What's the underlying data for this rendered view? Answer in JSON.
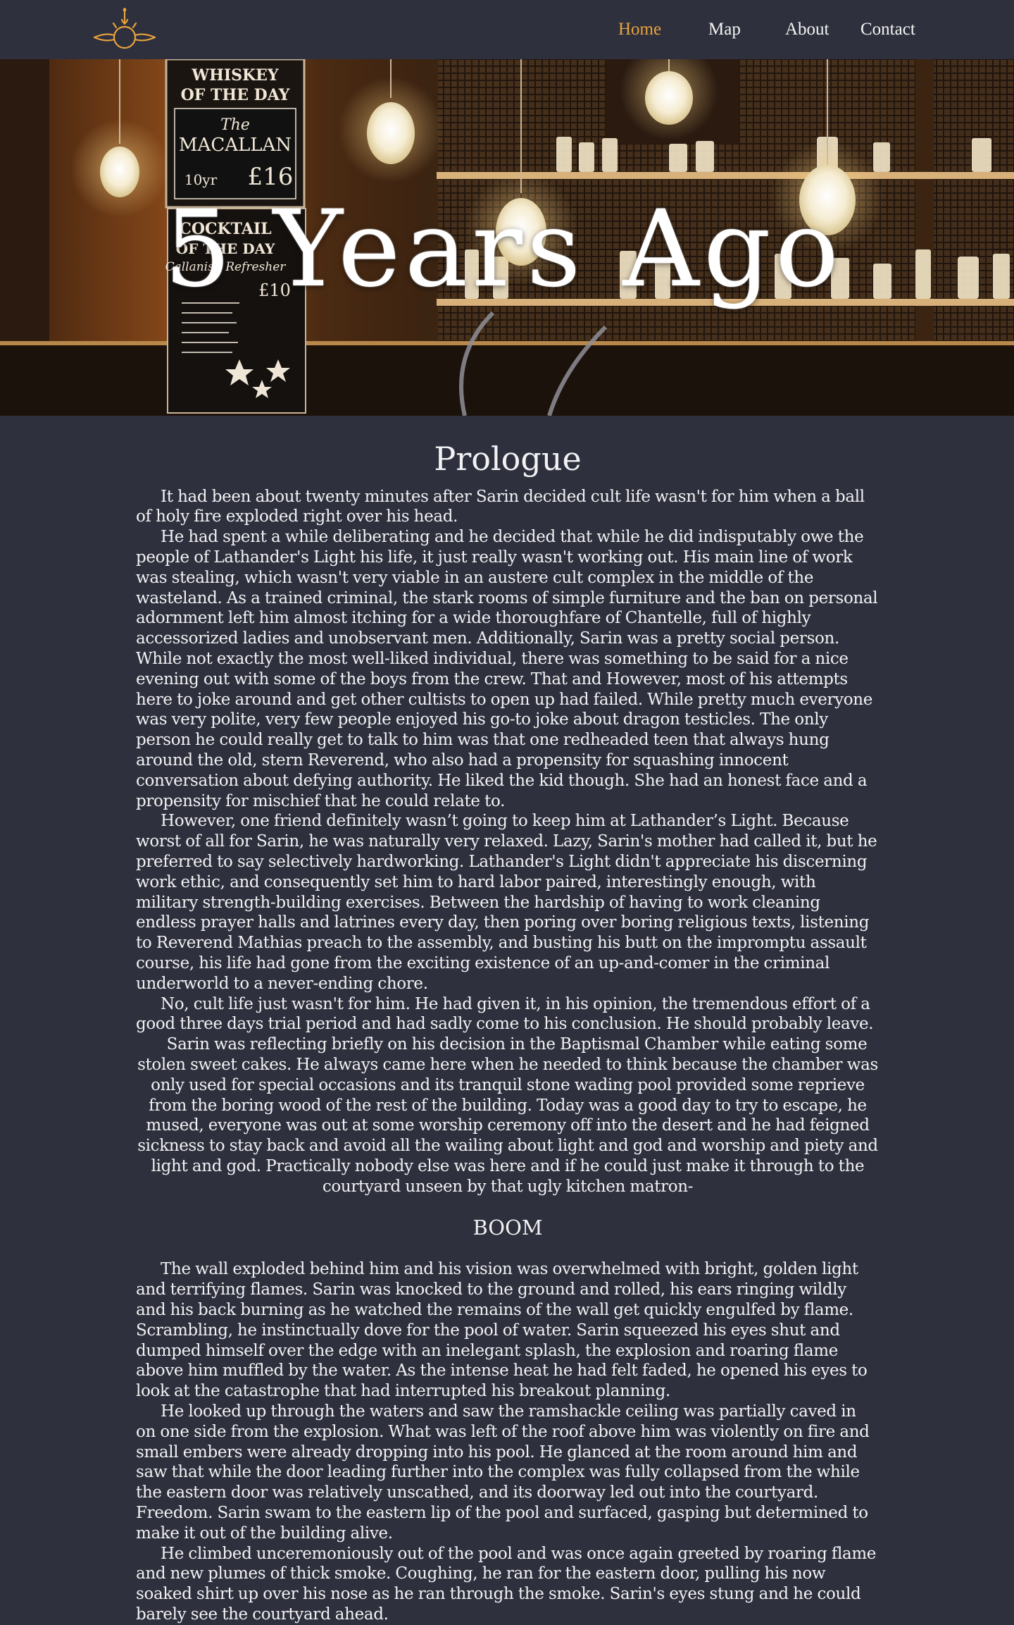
{
  "header": {
    "logo_name": "sun-compass-logo",
    "accent_color": "#e8a33d",
    "nav": [
      {
        "label": "Home",
        "active": true
      },
      {
        "label": "Map",
        "active": false
      },
      {
        "label": "About",
        "active": false
      },
      {
        "label": "Contact",
        "active": false
      }
    ]
  },
  "hero": {
    "title": "5 Years Ago",
    "signs": {
      "whiskey_line1": "WHISKEY",
      "whiskey_line2": "OF THE DAY",
      "the": "The",
      "macallan": "MACALLAN",
      "price_small": "10yr",
      "price": "£16",
      "cocktail_line1": "COCKTAIL",
      "cocktail_line2": "OF THE DAY",
      "cocktail_name": "Callanish Refresher",
      "cocktail_price": "£10"
    }
  },
  "story": {
    "chapter_title": "Prologue",
    "paragraphs_part1": [
      "It had been about twenty minutes after Sarin decided cult life wasn't for him when a ball of holy fire exploded right over his head.",
      "He had spent a while deliberating and he decided that while he did indisputably owe the people of Lathander's Light his life, it just really wasn't working out. His main line of work was stealing, which wasn't very viable in an austere cult complex in the middle of the wasteland. As a trained criminal, the stark rooms of simple furniture and the ban on personal adornment left him almost itching for a wide thoroughfare of Chantelle, full of highly accessorized ladies and unobservant men. Additionally, Sarin was a pretty social person. While not exactly the most well-liked individual, there was something to be said for a nice evening out with some of the boys from the crew. That and However, most of his attempts here to joke around and get other cultists to open up had failed. While pretty much everyone was very polite, very few people enjoyed his go-to joke about dragon testicles. The only person he could really get to talk to him was that one redheaded teen that always hung around the old, stern Reverend, who also had a propensity for squashing innocent conversation about defying authority. He liked the kid though. She had an honest face and a propensity for mischief that he could relate to.",
      "However, one friend definitely wasn’t going to keep him at Lathander’s Light. Because worst of all for Sarin, he was naturally very relaxed. Lazy, Sarin's mother had called it, but he preferred to say selectively hardworking. Lathander's Light didn't appreciate his discerning work ethic, and consequently set him to hard labor paired, interestingly enough, with military strength-building exercises. Between the hardship of having to work cleaning endless prayer halls and latrines every day, then poring over boring religious texts, listening to Reverend Mathias preach to the assembly, and busting his butt on the impromptu assault course, his life had gone from the exciting existence of an up-and-comer in the criminal underworld to a never-ending chore.",
      "No, cult life just wasn't for him. He had given it, in his opinion, the tremendous effort of a good three days trial period and had sadly come to his conclusion. He should probably leave."
    ],
    "paragraph_centered": "Sarin was reflecting briefly on his decision in the Baptismal Chamber while eating some stolen sweet cakes. He always came here when he needed to think because the chamber was only used for special occasions and its tranquil stone wading pool provided some reprieve from the boring wood of the rest of the building. Today was a good day to try to escape, he mused, everyone was out at some worship ceremony off into the desert and he had feigned sickness to stay back and avoid all the wailing about light and god and worship and piety and light and god. Practically nobody else was here and if he could just make it through to the courtyard unseen by that ugly kitchen matron-",
    "boom": "BOOM",
    "paragraphs_part2": [
      "The wall exploded behind him and his vision was overwhelmed with bright, golden light and terrifying flames. Sarin was knocked to the ground and rolled, his ears ringing wildly and his back burning as he watched the remains of the wall get quickly engulfed by flame. Scrambling, he instinctually dove for the pool of water. Sarin squeezed his eyes shut and dumped himself over the edge with an inelegant splash, the explosion and roaring flame above him muffled by the water. As the intense heat he had felt faded, he opened his eyes to look at the catastrophe that had interrupted his breakout planning.",
      "He looked up through the waters and saw the ramshackle ceiling was partially caved in on one side from the explosion. What was left of the roof above him was violently on fire and small embers were already dropping into his pool. He glanced at the room around him and saw that while the door leading further into the complex was fully collapsed from the while the eastern door was relatively unscathed, and its doorway led out into the courtyard. Freedom. Sarin swam to the eastern lip of the pool and surfaced, gasping but determined to make it out of the building alive.",
      "He climbed unceremoniously out of the pool and was once again greeted by roaring flame and new plumes of thick smoke. Coughing, he ran for the eastern door, pulling his now soaked shirt up over his nose as he ran through the smoke. Sarin's eyes stung and he could barely see the courtyard ahead."
    ]
  }
}
